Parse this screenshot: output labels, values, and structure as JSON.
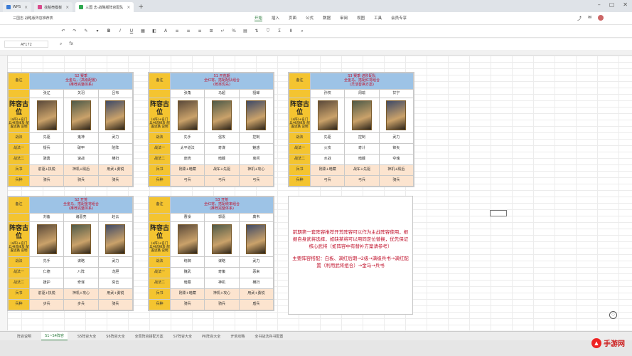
{
  "browser": {
    "tabs": [
      {
        "label": "WPS",
        "color": "#3a7bd5"
      },
      {
        "label": "找稻壳模板",
        "color": "#d94a8c"
      },
      {
        "label": "三国 志·战略版阵容配队",
        "color": "#2fa84f"
      }
    ]
  },
  "app": {
    "file_title": "三国志·战略版阵容推荐表",
    "menus": [
      "开始",
      "插入",
      "页面",
      "公式",
      "数据",
      "审阅",
      "视图",
      "工具",
      "会员专享"
    ],
    "active_menu": "开始"
  },
  "formula_bar": {
    "cell_ref": "AF172",
    "fx_label": "fx"
  },
  "cards": [
    {
      "note": "备注",
      "header_lines": [
        "S2 赛季",
        "全金马，(高级配置)",
        "(推荐完整体系)"
      ],
      "title": "阵容古位",
      "side_note": "(a阵)+名门 兵书选择及 配置思路 说明",
      "heroes": [
        "张辽",
        "关羽",
        "吕布"
      ],
      "rows": [
        {
          "k": "战法",
          "v": [
            "先驱",
            "鬼神",
            "武力"
          ]
        },
        {
          "k": "战法一",
          "v": [
            "疑兵",
            "破甲",
            "陷阵"
          ]
        },
        {
          "k": "战法二",
          "v": [
            "骁勇",
            "速战",
            "横扫"
          ]
        },
        {
          "k": "兵书",
          "v": [
            "前驱+执锐",
            "神机+殿后",
            "用武+勇锐"
          ]
        },
        {
          "k": "兵种",
          "v": [
            "骑兵",
            "骑兵",
            "骑兵"
          ]
        }
      ]
    },
    {
      "note": "备注",
      "header_lines": [
        "S1 开荒期",
        "全红将，搭配配队组合",
        "(统率优先)"
      ],
      "title": "阵容古位",
      "side_note": "(a阵)+名门 兵书选择及 配置思路 说明",
      "heroes": [
        "张角",
        "马超",
        "貂蝉"
      ],
      "rows": [
        {
          "k": "战法",
          "v": [
            "先手",
            "强攻",
            "控制"
          ]
        },
        {
          "k": "战法一",
          "v": [
            "太平道法",
            "奇谋",
            "魅惑"
          ]
        },
        {
          "k": "战法二",
          "v": [
            "庞统",
            "暗藏",
            "离间"
          ]
        },
        {
          "k": "兵书",
          "v": [
            "刚柔+暗藏",
            "战车+先驱",
            "神机+攻心"
          ]
        },
        {
          "k": "兵种",
          "v": [
            "弓兵",
            "弓兵",
            "弓兵"
          ]
        }
      ]
    },
    {
      "note": "备注",
      "header_lines": [
        "S3 赛季·进阶配队",
        "全金马，搭配红将组合",
        "(灵活替换方案)"
      ],
      "title": "阵容古位",
      "side_note": "(a阵)+名门 兵书选择及 配置思路 说明",
      "heroes": [
        "孙权",
        "周瑜",
        "甘宁"
      ],
      "rows": [
        {
          "k": "战法",
          "v": [
            "先驱",
            "控制",
            "武力"
          ]
        },
        {
          "k": "战法一",
          "v": [
            "火攻",
            "奇计",
            "锋矢"
          ]
        },
        {
          "k": "战法二",
          "v": [
            "水战",
            "暗藏",
            "夺魂"
          ]
        },
        {
          "k": "兵书",
          "v": [
            "刚柔+暗藏",
            "战车+先驱",
            "神机+殿后"
          ]
        },
        {
          "k": "兵种",
          "v": [
            "弓兵",
            "弓兵",
            "骑兵"
          ]
        }
      ]
    },
    {
      "note": "备注",
      "header_lines": [
        "S2 开荒",
        "全金马，搭配金将组合",
        "(推荐完整体系)"
      ],
      "title": "阵容古位",
      "side_note": "(a阵)+名门 兵书选择及 配置思路 说明",
      "heroes": [
        "刘备",
        "诸葛亮",
        "赵云"
      ],
      "rows": [
        {
          "k": "战法",
          "v": [
            "先手",
            "谋略",
            "武力"
          ]
        },
        {
          "k": "战法一",
          "v": [
            "仁德",
            "八阵",
            "龙胆"
          ]
        },
        {
          "k": "战法二",
          "v": [
            "援护",
            "奇谋",
            "突击"
          ]
        },
        {
          "k": "兵书",
          "v": [
            "前驱+执锐",
            "神机+攻心",
            "用武+勇锐"
          ]
        },
        {
          "k": "兵种",
          "v": [
            "步兵",
            "步兵",
            "骑兵"
          ]
        }
      ]
    },
    {
      "note": "备注",
      "header_lines": [
        "S3 开荒",
        "全红将，搭配统率组合",
        "(推荐完整体系)"
      ],
      "title": "阵容古位",
      "side_note": "(a阵)+名门 兵书选择及 配置思路 说明",
      "heroes": [
        "曹操",
        "郭嘉",
        "典韦"
      ],
      "rows": [
        {
          "k": "战法",
          "v": [
            "统御",
            "谋略",
            "武力"
          ]
        },
        {
          "k": "战法一",
          "v": [
            "魏武",
            "奇策",
            "恶来"
          ]
        },
        {
          "k": "战法二",
          "v": [
            "暗藏",
            "神机",
            "横扫"
          ]
        },
        {
          "k": "兵书",
          "v": [
            "刚柔+暗藏",
            "神机+攻心",
            "用武+勇锐"
          ]
        },
        {
          "k": "兵种",
          "v": [
            "骑兵",
            "骑兵",
            "盾兵"
          ]
        }
      ]
    }
  ],
  "text_card": {
    "para1": "前期第一套阵容推荐开荒阵容可以作为主战阵容使用，根据自身武将选择，如缺某将可以用同定位替换，优先保证核心武将（如阵容中有替补方案请参考）",
    "para2": "主要阵容搭配：白板、满红后期→2级→满级兵书→满红配置（利用武将组合）→金马→兵书"
  },
  "sheet_tabs": [
    "阵容说明",
    "S1~S4阵容",
    "S5阵容大全",
    "S6阵容大全",
    "全局阵容搭配方案",
    "S7阵容大全",
    "PK阵容大全",
    "开荒攻略",
    "全书战法兵书配置"
  ],
  "active_sheet": "S1~S4阵容",
  "watermark": "手游网"
}
